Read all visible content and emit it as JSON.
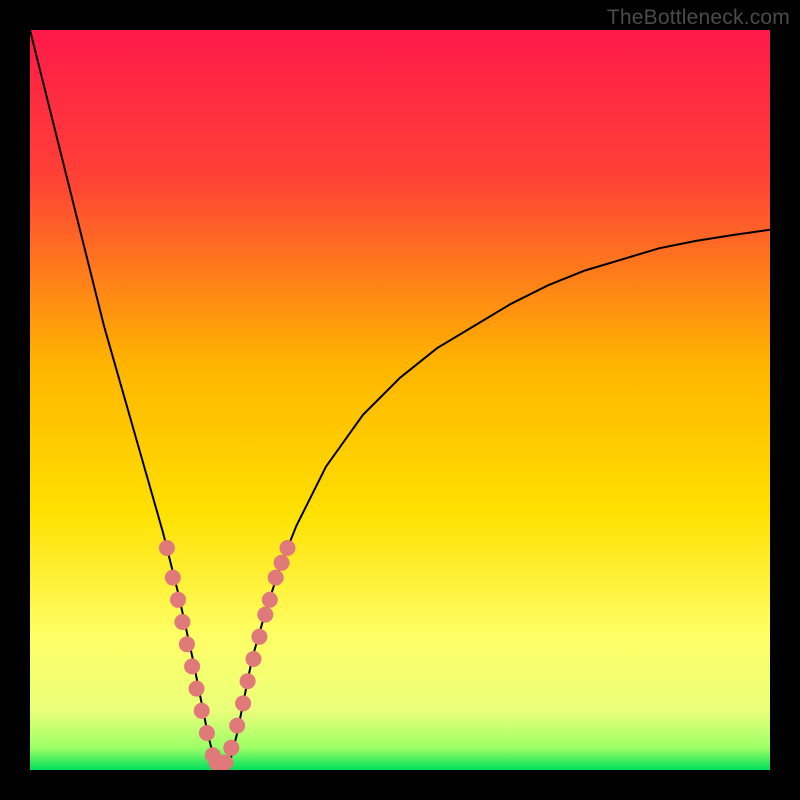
{
  "watermark": "TheBottleneck.com",
  "chart_data": {
    "type": "line",
    "title": "",
    "xlabel": "",
    "ylabel": "",
    "xlim": [
      0,
      100
    ],
    "ylim": [
      0,
      100
    ],
    "grid": false,
    "gradient_stops": [
      {
        "offset": 0,
        "color": "#ff1a4a"
      },
      {
        "offset": 20,
        "color": "#ff4136"
      },
      {
        "offset": 45,
        "color": "#ffb400"
      },
      {
        "offset": 65,
        "color": "#ffe000"
      },
      {
        "offset": 82,
        "color": "#ffff66"
      },
      {
        "offset": 92,
        "color": "#eaff7a"
      },
      {
        "offset": 97,
        "color": "#9dff66"
      },
      {
        "offset": 100,
        "color": "#00e05c"
      }
    ],
    "series": [
      {
        "name": "bottleneck-curve",
        "color": "#000000",
        "stroke_width": 2,
        "x": [
          0,
          2,
          4,
          6,
          8,
          10,
          12,
          14,
          16,
          18,
          20,
          22,
          23,
          24,
          25,
          26,
          27,
          28,
          29,
          30,
          32,
          34,
          36,
          40,
          45,
          50,
          55,
          60,
          65,
          70,
          75,
          80,
          85,
          90,
          95,
          100
        ],
        "y": [
          100,
          92,
          84,
          76,
          68,
          60,
          53,
          46,
          39,
          32,
          24,
          15,
          10,
          5,
          1,
          0,
          1,
          5,
          10,
          15,
          22,
          28,
          33,
          41,
          48,
          53,
          57,
          60,
          63,
          65.5,
          67.5,
          69,
          70.5,
          71.5,
          72.3,
          73
        ]
      }
    ],
    "markers": {
      "name": "sample-points",
      "color": "#e07a7a",
      "radius": 8,
      "points": [
        {
          "x": 18.5,
          "y": 30
        },
        {
          "x": 19.3,
          "y": 26
        },
        {
          "x": 20.0,
          "y": 23
        },
        {
          "x": 20.6,
          "y": 20
        },
        {
          "x": 21.2,
          "y": 17
        },
        {
          "x": 21.9,
          "y": 14
        },
        {
          "x": 22.5,
          "y": 11
        },
        {
          "x": 23.2,
          "y": 8
        },
        {
          "x": 23.9,
          "y": 5
        },
        {
          "x": 24.7,
          "y": 2
        },
        {
          "x": 25.2,
          "y": 1
        },
        {
          "x": 25.8,
          "y": 1
        },
        {
          "x": 26.4,
          "y": 1
        },
        {
          "x": 27.2,
          "y": 3
        },
        {
          "x": 28.0,
          "y": 6
        },
        {
          "x": 28.8,
          "y": 9
        },
        {
          "x": 29.4,
          "y": 12
        },
        {
          "x": 30.2,
          "y": 15
        },
        {
          "x": 31.0,
          "y": 18
        },
        {
          "x": 31.8,
          "y": 21
        },
        {
          "x": 32.4,
          "y": 23
        },
        {
          "x": 33.2,
          "y": 26
        },
        {
          "x": 34.0,
          "y": 28
        },
        {
          "x": 34.8,
          "y": 30
        }
      ]
    },
    "annotations": []
  }
}
